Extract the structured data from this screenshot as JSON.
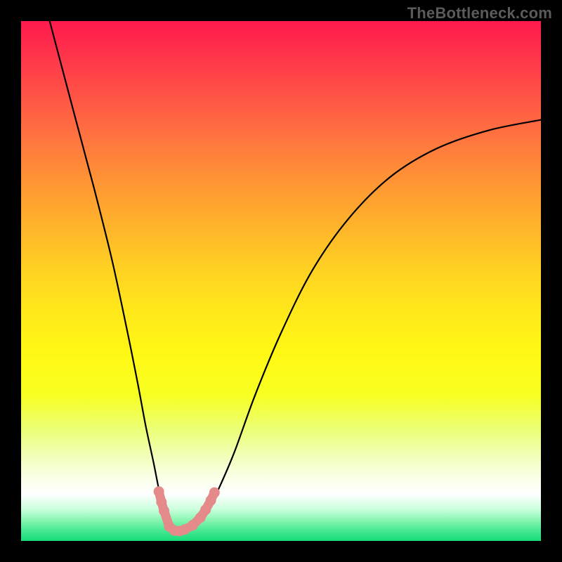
{
  "watermark": "TheBottleneck.com",
  "chart_data": {
    "type": "line",
    "title": "",
    "xlabel": "",
    "ylabel": "",
    "xlim": [
      0,
      1
    ],
    "ylim": [
      0,
      1
    ],
    "grid": false,
    "legend": false,
    "background_gradient": {
      "direction": "vertical",
      "stops": [
        {
          "pos": 0.0,
          "color": "#ff1a4d"
        },
        {
          "pos": 0.5,
          "color": "#ffe81a"
        },
        {
          "pos": 0.9,
          "color": "#ffffff"
        },
        {
          "pos": 1.0,
          "color": "#15dd78"
        }
      ]
    },
    "series": [
      {
        "name": "curve",
        "x": [
          0.055,
          0.1,
          0.14,
          0.175,
          0.205,
          0.225,
          0.24,
          0.255,
          0.265,
          0.275,
          0.28,
          0.285,
          0.29,
          0.3,
          0.31,
          0.33,
          0.36,
          0.38,
          0.41,
          0.45,
          0.5,
          0.56,
          0.63,
          0.71,
          0.8,
          0.9,
          1.0
        ],
        "y": [
          1.0,
          0.83,
          0.68,
          0.54,
          0.4,
          0.3,
          0.22,
          0.15,
          0.1,
          0.06,
          0.04,
          0.025,
          0.02,
          0.018,
          0.02,
          0.03,
          0.06,
          0.1,
          0.17,
          0.28,
          0.4,
          0.52,
          0.62,
          0.7,
          0.755,
          0.79,
          0.81
        ]
      }
    ],
    "markers": {
      "name": "highlight",
      "color": "#e58a8a",
      "points": [
        {
          "x": 0.265,
          "y": 0.095
        },
        {
          "x": 0.27,
          "y": 0.075
        },
        {
          "x": 0.275,
          "y": 0.058
        },
        {
          "x": 0.285,
          "y": 0.028
        },
        {
          "x": 0.295,
          "y": 0.02
        },
        {
          "x": 0.305,
          "y": 0.019
        },
        {
          "x": 0.315,
          "y": 0.022
        },
        {
          "x": 0.33,
          "y": 0.03
        },
        {
          "x": 0.345,
          "y": 0.045
        },
        {
          "x": 0.355,
          "y": 0.06
        },
        {
          "x": 0.365,
          "y": 0.078
        },
        {
          "x": 0.372,
          "y": 0.093
        }
      ]
    }
  }
}
